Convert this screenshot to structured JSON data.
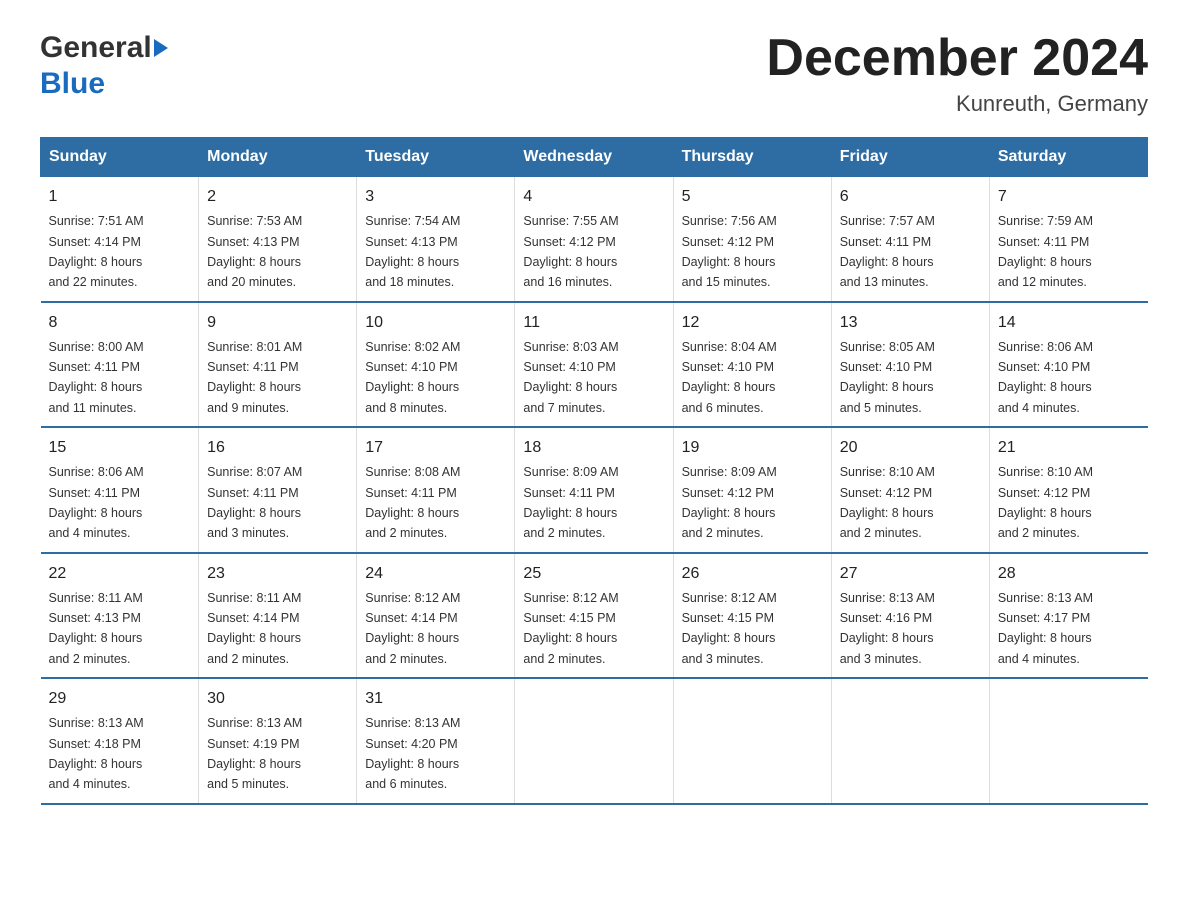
{
  "header": {
    "logo_line1": "General",
    "logo_line2": "Blue",
    "month_title": "December 2024",
    "location": "Kunreuth, Germany"
  },
  "weekdays": [
    "Sunday",
    "Monday",
    "Tuesday",
    "Wednesday",
    "Thursday",
    "Friday",
    "Saturday"
  ],
  "weeks": [
    [
      {
        "day": "1",
        "sunrise": "7:51 AM",
        "sunset": "4:14 PM",
        "daylight": "8 hours and 22 minutes."
      },
      {
        "day": "2",
        "sunrise": "7:53 AM",
        "sunset": "4:13 PM",
        "daylight": "8 hours and 20 minutes."
      },
      {
        "day": "3",
        "sunrise": "7:54 AM",
        "sunset": "4:13 PM",
        "daylight": "8 hours and 18 minutes."
      },
      {
        "day": "4",
        "sunrise": "7:55 AM",
        "sunset": "4:12 PM",
        "daylight": "8 hours and 16 minutes."
      },
      {
        "day": "5",
        "sunrise": "7:56 AM",
        "sunset": "4:12 PM",
        "daylight": "8 hours and 15 minutes."
      },
      {
        "day": "6",
        "sunrise": "7:57 AM",
        "sunset": "4:11 PM",
        "daylight": "8 hours and 13 minutes."
      },
      {
        "day": "7",
        "sunrise": "7:59 AM",
        "sunset": "4:11 PM",
        "daylight": "8 hours and 12 minutes."
      }
    ],
    [
      {
        "day": "8",
        "sunrise": "8:00 AM",
        "sunset": "4:11 PM",
        "daylight": "8 hours and 11 minutes."
      },
      {
        "day": "9",
        "sunrise": "8:01 AM",
        "sunset": "4:11 PM",
        "daylight": "8 hours and 9 minutes."
      },
      {
        "day": "10",
        "sunrise": "8:02 AM",
        "sunset": "4:10 PM",
        "daylight": "8 hours and 8 minutes."
      },
      {
        "day": "11",
        "sunrise": "8:03 AM",
        "sunset": "4:10 PM",
        "daylight": "8 hours and 7 minutes."
      },
      {
        "day": "12",
        "sunrise": "8:04 AM",
        "sunset": "4:10 PM",
        "daylight": "8 hours and 6 minutes."
      },
      {
        "day": "13",
        "sunrise": "8:05 AM",
        "sunset": "4:10 PM",
        "daylight": "8 hours and 5 minutes."
      },
      {
        "day": "14",
        "sunrise": "8:06 AM",
        "sunset": "4:10 PM",
        "daylight": "8 hours and 4 minutes."
      }
    ],
    [
      {
        "day": "15",
        "sunrise": "8:06 AM",
        "sunset": "4:11 PM",
        "daylight": "8 hours and 4 minutes."
      },
      {
        "day": "16",
        "sunrise": "8:07 AM",
        "sunset": "4:11 PM",
        "daylight": "8 hours and 3 minutes."
      },
      {
        "day": "17",
        "sunrise": "8:08 AM",
        "sunset": "4:11 PM",
        "daylight": "8 hours and 2 minutes."
      },
      {
        "day": "18",
        "sunrise": "8:09 AM",
        "sunset": "4:11 PM",
        "daylight": "8 hours and 2 minutes."
      },
      {
        "day": "19",
        "sunrise": "8:09 AM",
        "sunset": "4:12 PM",
        "daylight": "8 hours and 2 minutes."
      },
      {
        "day": "20",
        "sunrise": "8:10 AM",
        "sunset": "4:12 PM",
        "daylight": "8 hours and 2 minutes."
      },
      {
        "day": "21",
        "sunrise": "8:10 AM",
        "sunset": "4:12 PM",
        "daylight": "8 hours and 2 minutes."
      }
    ],
    [
      {
        "day": "22",
        "sunrise": "8:11 AM",
        "sunset": "4:13 PM",
        "daylight": "8 hours and 2 minutes."
      },
      {
        "day": "23",
        "sunrise": "8:11 AM",
        "sunset": "4:14 PM",
        "daylight": "8 hours and 2 minutes."
      },
      {
        "day": "24",
        "sunrise": "8:12 AM",
        "sunset": "4:14 PM",
        "daylight": "8 hours and 2 minutes."
      },
      {
        "day": "25",
        "sunrise": "8:12 AM",
        "sunset": "4:15 PM",
        "daylight": "8 hours and 2 minutes."
      },
      {
        "day": "26",
        "sunrise": "8:12 AM",
        "sunset": "4:15 PM",
        "daylight": "8 hours and 3 minutes."
      },
      {
        "day": "27",
        "sunrise": "8:13 AM",
        "sunset": "4:16 PM",
        "daylight": "8 hours and 3 minutes."
      },
      {
        "day": "28",
        "sunrise": "8:13 AM",
        "sunset": "4:17 PM",
        "daylight": "8 hours and 4 minutes."
      }
    ],
    [
      {
        "day": "29",
        "sunrise": "8:13 AM",
        "sunset": "4:18 PM",
        "daylight": "8 hours and 4 minutes."
      },
      {
        "day": "30",
        "sunrise": "8:13 AM",
        "sunset": "4:19 PM",
        "daylight": "8 hours and 5 minutes."
      },
      {
        "day": "31",
        "sunrise": "8:13 AM",
        "sunset": "4:20 PM",
        "daylight": "8 hours and 6 minutes."
      },
      null,
      null,
      null,
      null
    ]
  ],
  "labels": {
    "sunrise": "Sunrise:",
    "sunset": "Sunset:",
    "daylight": "Daylight:"
  }
}
